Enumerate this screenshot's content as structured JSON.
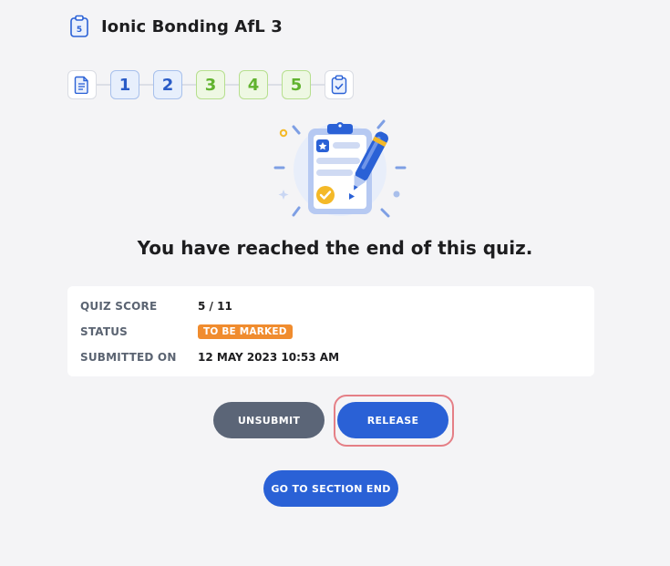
{
  "header": {
    "title": "Ionic Bonding AfL 3",
    "quiz_icon_number": "5",
    "icon": "clipboard-icon"
  },
  "stepper": {
    "steps": [
      {
        "label": "",
        "icon": "document-icon",
        "style": "doc"
      },
      {
        "label": "1",
        "style": "blue"
      },
      {
        "label": "2",
        "style": "blue"
      },
      {
        "label": "3",
        "style": "green"
      },
      {
        "label": "4",
        "style": "green"
      },
      {
        "label": "5",
        "style": "green"
      },
      {
        "label": "",
        "icon": "clipboard-check-icon",
        "style": "doc"
      }
    ]
  },
  "main": {
    "end_message": "You have reached the end of this quiz.",
    "illustration_icon": "clipboard-pen-illustration"
  },
  "summary": {
    "rows": [
      {
        "label": "QUIZ SCORE",
        "value": "5 / 11"
      },
      {
        "label": "STATUS",
        "value": "TO BE MARKED"
      },
      {
        "label": "SUBMITTED ON",
        "value": "12 MAY 2023 10:53 AM"
      }
    ]
  },
  "actions": {
    "unsubmit_label": "UNSUBMIT",
    "release_label": "RELEASE",
    "section_end_label": "GO TO SECTION END"
  },
  "colors": {
    "primary": "#2a61d6",
    "secondary": "#5b6577",
    "status_orange": "#f08c2e",
    "step_blue": "#2a5cc7",
    "step_green": "#61b32f",
    "highlight": "#e57f86"
  }
}
